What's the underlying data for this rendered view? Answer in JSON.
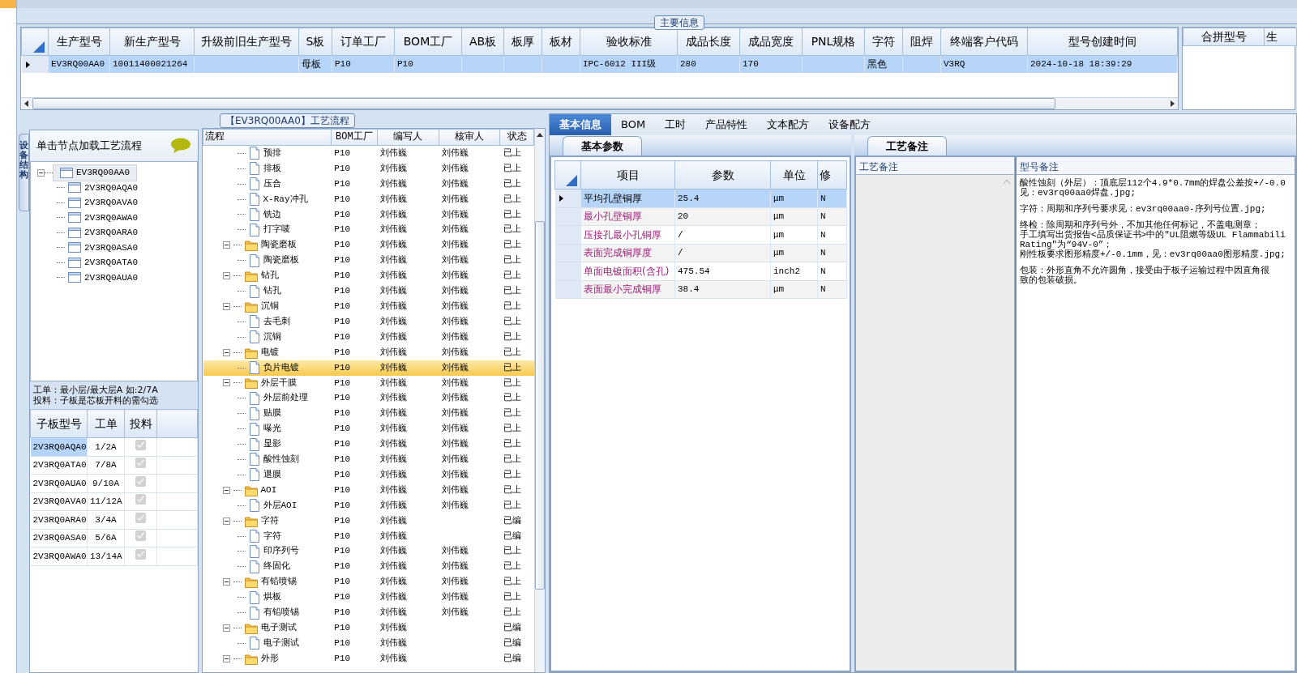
{
  "main_info": {
    "title": "主要信息",
    "columns": [
      "生产型号",
      "新生产型号",
      "升级前旧生产型号",
      "S板",
      "订单工厂",
      "BOM工厂",
      "AB板",
      "板厚",
      "板材",
      "验收标准",
      "成品长度",
      "成品宽度",
      "PNL规格",
      "字符",
      "阻焊",
      "终端客户代码",
      "型号创建时间"
    ],
    "rows": [
      {
        "selected": true,
        "cells": [
          "EV3RQ00AA0",
          "10011400021264",
          "",
          "母板",
          "P10",
          "P10",
          "",
          "",
          "",
          "IPC-6012 III级",
          "280",
          "170",
          "",
          "黑色",
          "",
          "V3RQ",
          "2024-10-18 18:39:29"
        ]
      }
    ],
    "side_columns": [
      "合拼型号",
      "生"
    ]
  },
  "structure": {
    "tab": "设备结构",
    "hint": "单击节点加载工艺流程",
    "tree": {
      "label": "EV3RQ00AA0",
      "expanded": true,
      "selected": true,
      "children": [
        {
          "label": "2V3RQ0AQA0",
          "selected": false
        },
        {
          "label": "2V3RQ0AVA0",
          "selected": false
        },
        {
          "label": "2V3RQ0AWA0",
          "selected": false
        },
        {
          "label": "2V3RQ0ARA0",
          "selected": false
        },
        {
          "label": "2V3RQ0ASA0",
          "selected": false
        },
        {
          "label": "2V3RQ0ATA0",
          "selected": false
        },
        {
          "label": "2V3RQ0AUA0",
          "selected": false
        }
      ]
    },
    "note_lines": [
      "工单：最小层/最大层A 如:2/7A",
      "投料：子板是芯板开料的需勾选"
    ],
    "sub_boards": {
      "columns": [
        "子板型号",
        "工单",
        "投料"
      ],
      "rows": [
        {
          "model": "2V3RQ0AQA0",
          "order": "1/2A",
          "feed": true,
          "selected": true
        },
        {
          "model": "2V3RQ0ATA0",
          "order": "7/8A",
          "feed": true,
          "selected": false
        },
        {
          "model": "2V3RQ0AUA0",
          "order": "9/10A",
          "feed": true,
          "selected": false
        },
        {
          "model": "2V3RQ0AVA0",
          "order": "11/12A",
          "feed": true,
          "selected": false
        },
        {
          "model": "2V3RQ0ARA0",
          "order": "3/4A",
          "feed": true,
          "selected": false
        },
        {
          "model": "2V3RQ0ASA0",
          "order": "5/6A",
          "feed": true,
          "selected": false
        },
        {
          "model": "2V3RQ0AWA0",
          "order": "13/14A",
          "feed": true,
          "selected": false
        }
      ]
    }
  },
  "process": {
    "title": "【EV3RQ00AA0】工艺流程",
    "columns": [
      "流程",
      "BOM工厂",
      "编写人",
      "核审人",
      "状态"
    ],
    "tree": [
      {
        "kind": "group",
        "children": [
          {
            "kind": "step",
            "label": "预排",
            "bom_factory": "P10",
            "author": "刘伟巍",
            "reviewer": "刘伟巍",
            "status": "已上",
            "selected": false
          },
          {
            "kind": "step",
            "label": "排板",
            "bom_factory": "P10",
            "author": "刘伟巍",
            "reviewer": "刘伟巍",
            "status": "已上",
            "selected": false
          },
          {
            "kind": "step",
            "label": "压合",
            "bom_factory": "P10",
            "author": "刘伟巍",
            "reviewer": "刘伟巍",
            "status": "已上",
            "selected": false
          },
          {
            "kind": "step",
            "label": "X-Ray冲孔",
            "bom_factory": "P10",
            "author": "刘伟巍",
            "reviewer": "刘伟巍",
            "status": "已上",
            "selected": false
          },
          {
            "kind": "step",
            "label": "铣边",
            "bom_factory": "P10",
            "author": "刘伟巍",
            "reviewer": "刘伟巍",
            "status": "已上",
            "selected": false
          },
          {
            "kind": "step",
            "label": "打字唛",
            "bom_factory": "P10",
            "author": "刘伟巍",
            "reviewer": "刘伟巍",
            "status": "已上",
            "selected": false
          }
        ]
      },
      {
        "kind": "folder",
        "label": "陶瓷磨板",
        "expanded": true,
        "bom_factory": "P10",
        "author": "刘伟巍",
        "reviewer": "刘伟巍",
        "status": "已上",
        "selected": false,
        "children": [
          {
            "kind": "step",
            "label": "陶瓷磨板",
            "bom_factory": "P10",
            "author": "刘伟巍",
            "reviewer": "刘伟巍",
            "status": "已上",
            "selected": false
          }
        ]
      },
      {
        "kind": "folder",
        "label": "钻孔",
        "expanded": true,
        "bom_factory": "P10",
        "author": "刘伟巍",
        "reviewer": "刘伟巍",
        "status": "已上",
        "selected": false,
        "children": [
          {
            "kind": "step",
            "label": "钻孔",
            "bom_factory": "P10",
            "author": "刘伟巍",
            "reviewer": "刘伟巍",
            "status": "已上",
            "selected": false
          }
        ]
      },
      {
        "kind": "folder",
        "label": "沉铜",
        "expanded": true,
        "bom_factory": "P10",
        "author": "刘伟巍",
        "reviewer": "刘伟巍",
        "status": "已上",
        "selected": false,
        "children": [
          {
            "kind": "step",
            "label": "去毛刺",
            "bom_factory": "P10",
            "author": "刘伟巍",
            "reviewer": "刘伟巍",
            "status": "已上",
            "selected": false
          },
          {
            "kind": "step",
            "label": "沉铜",
            "bom_factory": "P10",
            "author": "刘伟巍",
            "reviewer": "刘伟巍",
            "status": "已上",
            "selected": false
          }
        ]
      },
      {
        "kind": "folder",
        "label": "电镀",
        "expanded": true,
        "bom_factory": "P10",
        "author": "刘伟巍",
        "reviewer": "刘伟巍",
        "status": "已上",
        "selected": false,
        "children": [
          {
            "kind": "step",
            "label": "负片电镀",
            "bom_factory": "P10",
            "author": "刘伟巍",
            "reviewer": "刘伟巍",
            "status": "已上",
            "selected": true
          }
        ]
      },
      {
        "kind": "folder",
        "label": "外层干膜",
        "expanded": true,
        "bom_factory": "P10",
        "author": "刘伟巍",
        "reviewer": "刘伟巍",
        "status": "已上",
        "selected": false,
        "children": [
          {
            "kind": "step",
            "label": "外层前处理",
            "bom_factory": "P10",
            "author": "刘伟巍",
            "reviewer": "刘伟巍",
            "status": "已上",
            "selected": false
          },
          {
            "kind": "step",
            "label": "贴膜",
            "bom_factory": "P10",
            "author": "刘伟巍",
            "reviewer": "刘伟巍",
            "status": "已上",
            "selected": false
          },
          {
            "kind": "step",
            "label": "曝光",
            "bom_factory": "P10",
            "author": "刘伟巍",
            "reviewer": "刘伟巍",
            "status": "已上",
            "selected": false
          },
          {
            "kind": "step",
            "label": "显影",
            "bom_factory": "P10",
            "author": "刘伟巍",
            "reviewer": "刘伟巍",
            "status": "已上",
            "selected": false
          },
          {
            "kind": "step",
            "label": "酸性蚀刻",
            "bom_factory": "P10",
            "author": "刘伟巍",
            "reviewer": "刘伟巍",
            "status": "已上",
            "selected": false
          },
          {
            "kind": "step",
            "label": "退膜",
            "bom_factory": "P10",
            "author": "刘伟巍",
            "reviewer": "刘伟巍",
            "status": "已上",
            "selected": false
          }
        ]
      },
      {
        "kind": "folder",
        "label": "AOI",
        "expanded": true,
        "bom_factory": "P10",
        "author": "刘伟巍",
        "reviewer": "刘伟巍",
        "status": "已上",
        "selected": false,
        "children": [
          {
            "kind": "step",
            "label": "外层AOI",
            "bom_factory": "P10",
            "author": "刘伟巍",
            "reviewer": "刘伟巍",
            "status": "已上",
            "selected": false
          }
        ]
      },
      {
        "kind": "folder",
        "label": "字符",
        "expanded": true,
        "bom_factory": "P10",
        "author": "刘伟巍",
        "status": "已编",
        "selected": false,
        "children": [
          {
            "kind": "step",
            "label": "字符",
            "bom_factory": "P10",
            "author": "刘伟巍",
            "status": "已编",
            "selected": false
          },
          {
            "kind": "step",
            "label": "印序列号",
            "bom_factory": "P10",
            "author": "刘伟巍",
            "reviewer": "刘伟巍",
            "status": "已上",
            "selected": false
          },
          {
            "kind": "step",
            "label": "终固化",
            "bom_factory": "P10",
            "author": "刘伟巍",
            "reviewer": "刘伟巍",
            "status": "已上",
            "selected": false
          }
        ]
      },
      {
        "kind": "folder",
        "label": "有铅喷锡",
        "expanded": true,
        "bom_factory": "P10",
        "author": "刘伟巍",
        "reviewer": "刘伟巍",
        "status": "已上",
        "selected": false,
        "children": [
          {
            "kind": "step",
            "label": "烘板",
            "bom_factory": "P10",
            "author": "刘伟巍",
            "reviewer": "刘伟巍",
            "status": "已上",
            "selected": false
          },
          {
            "kind": "step",
            "label": "有铅喷锡",
            "bom_factory": "P10",
            "author": "刘伟巍",
            "reviewer": "刘伟巍",
            "status": "已上",
            "selected": false
          }
        ]
      },
      {
        "kind": "folder",
        "label": "电子测试",
        "expanded": true,
        "bom_factory": "P10",
        "author": "刘伟巍",
        "status": "已编",
        "selected": false,
        "children": [
          {
            "kind": "step",
            "label": "电子测试",
            "bom_factory": "P10",
            "author": "刘伟巍",
            "status": "已编",
            "selected": false
          }
        ]
      },
      {
        "kind": "folder",
        "label": "外形",
        "expanded": true,
        "bom_factory": "P10",
        "author": "刘伟巍",
        "status": "已编",
        "selected": false
      }
    ]
  },
  "detail": {
    "tabs": [
      {
        "label": "基本信息",
        "selected": true
      },
      {
        "label": "BOM",
        "selected": false
      },
      {
        "label": "工时",
        "selected": false
      },
      {
        "label": "产品特性",
        "selected": false
      },
      {
        "label": "文本配方",
        "selected": false
      },
      {
        "label": "设备配方",
        "selected": false
      }
    ],
    "params_tab": "基本参数",
    "params": {
      "columns": [
        "项目",
        "参数",
        "单位",
        "修"
      ],
      "rows": [
        {
          "item": "平均孔壁铜厚",
          "value": "25.4",
          "unit": "μm",
          "modified": "N",
          "highlighted": false,
          "selected": true
        },
        {
          "item": "最小孔壁铜厚",
          "value": "20",
          "unit": "μm",
          "modified": "N",
          "highlighted": true,
          "selected": false
        },
        {
          "item": "压接孔最小孔铜厚",
          "value": "/",
          "unit": "μm",
          "modified": "N",
          "highlighted": true,
          "selected": false
        },
        {
          "item": "表面完成铜厚度",
          "value": "/",
          "unit": "μm",
          "modified": "N",
          "highlighted": true,
          "selected": false
        },
        {
          "item": "单面电镀面积(含孔)",
          "value": "475.54",
          "unit": "inch2",
          "modified": "N",
          "highlighted": true,
          "selected": false
        },
        {
          "item": "表面最小完成铜厚",
          "value": "38.4",
          "unit": "μm",
          "modified": "N",
          "highlighted": true,
          "selected": false
        }
      ]
    },
    "notes_tab": "工艺备注",
    "notes_columns": [
      "工艺备注",
      "型号备注"
    ],
    "notes": [
      [
        "酸性蚀刻（外层）：顶底层112个4.9*0.7mm的焊盘公差按+/-0.0",
        "见：ev3rq00aa0焊盘.jpg;"
      ],
      [
        "字符：周期和序列号要求见：ev3rq00aa0-序列号位置.jpg;"
      ],
      [
        "终检：除周期和序列号外，不加其他任何标记，不盖电测章；",
        "手工填写出货报告<品质保证书>中的\"UL阻燃等级UL Flammabili",
        "Rating\"为“94V-0”；",
        "刚性板要求图形精度+/-0.1mm，见：ev3rq00aa0图形精度.jpg;"
      ],
      [
        "包装：外形直角不允许圆角，接受由于板子运输过程中因直角很",
        "致的包装破损。"
      ]
    ]
  }
}
